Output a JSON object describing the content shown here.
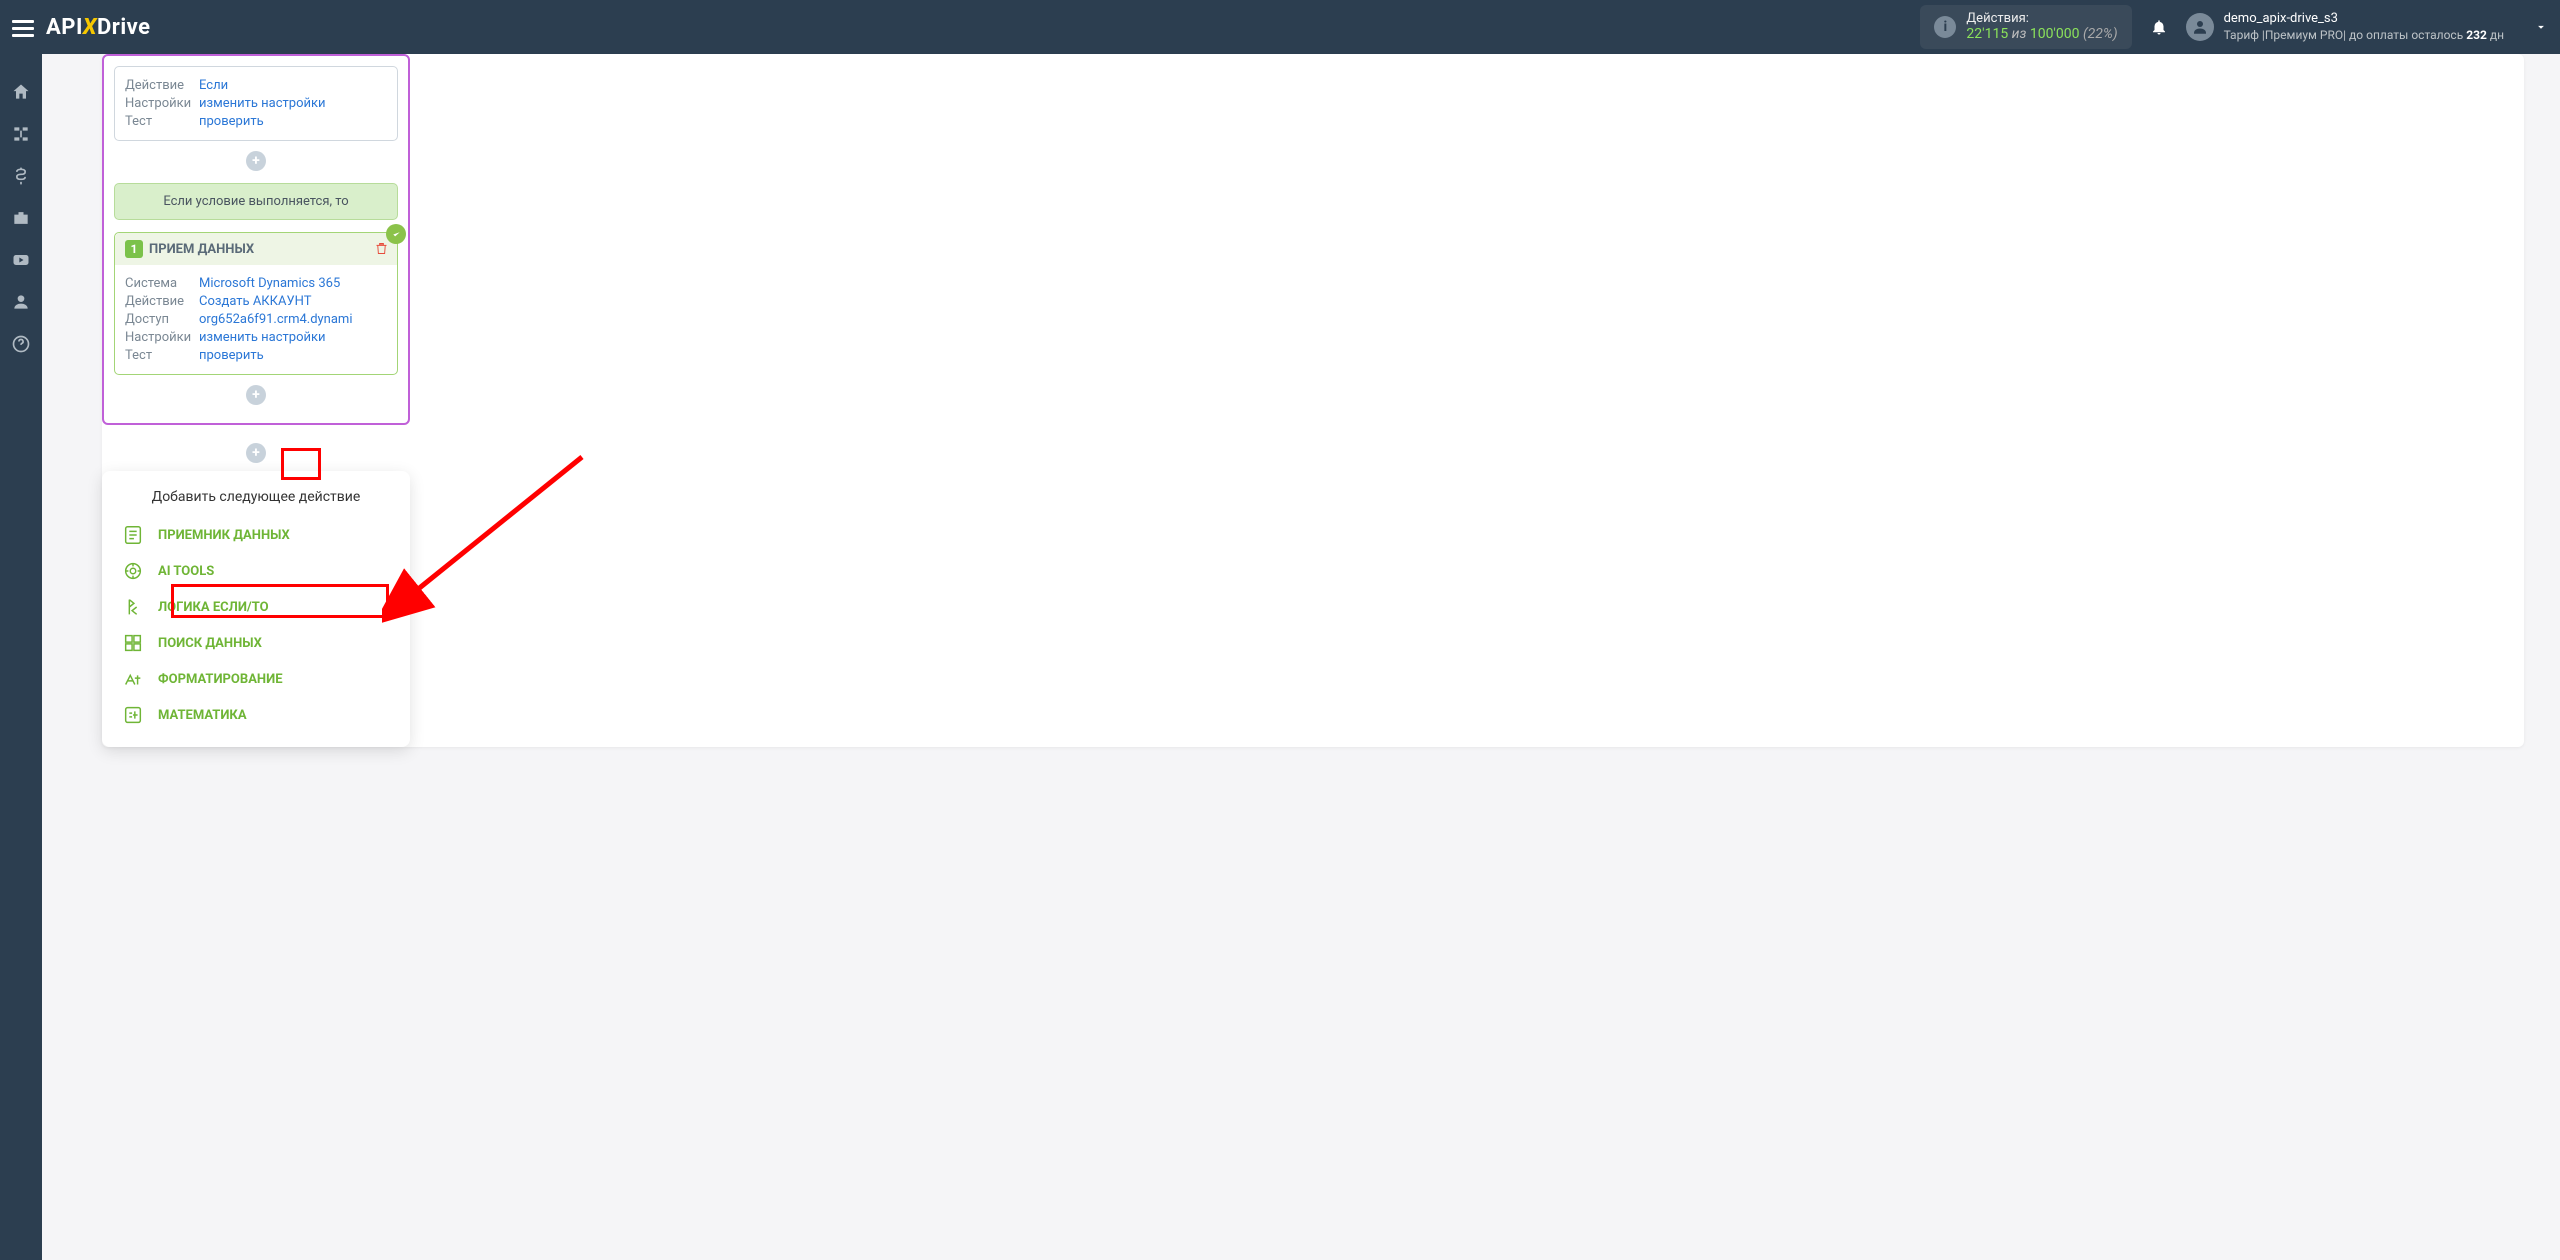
{
  "topbar": {
    "logo_part1": "API",
    "logo_part2": "Drive",
    "actions_label": "Действия:",
    "actions_used": "22'115",
    "actions_of": " из ",
    "actions_limit": "100'000",
    "actions_percent": "(22%)",
    "user_name": "demo_apix-drive_s3",
    "tariff_prefix": "Тариф |",
    "tariff_name": "Премиум PRO",
    "pay_prefix": "| до оплаты осталось ",
    "pay_days": "232",
    "pay_suffix": " дн"
  },
  "step1": {
    "rows": [
      {
        "lbl": "Действие",
        "val": "Если"
      },
      {
        "lbl": "Настройки",
        "val": "изменить настройки"
      },
      {
        "lbl": "Тест",
        "val": "проверить"
      }
    ]
  },
  "cond_text": "Если условие выполняется, то",
  "step2": {
    "num": "1",
    "title": "ПРИЕМ ДАННЫХ",
    "rows": [
      {
        "lbl": "Система",
        "val": "Microsoft Dynamics 365"
      },
      {
        "lbl": "Действие",
        "val": "Создать АККАУНТ"
      },
      {
        "lbl": "Доступ",
        "val": "org652a6f91.crm4.dynami"
      },
      {
        "lbl": "Настройки",
        "val": "изменить настройки"
      },
      {
        "lbl": "Тест",
        "val": "проверить"
      }
    ]
  },
  "popup": {
    "title": "Добавить следующее действие",
    "items": [
      "ПРИЕМНИК ДАННЫХ",
      "AI TOOLS",
      "ЛОГИКА ЕСЛИ/ТО",
      "ПОИСК ДАННЫХ",
      "ФОРМАТИРОВАНИЕ",
      "МАТЕМАТИКА"
    ]
  }
}
